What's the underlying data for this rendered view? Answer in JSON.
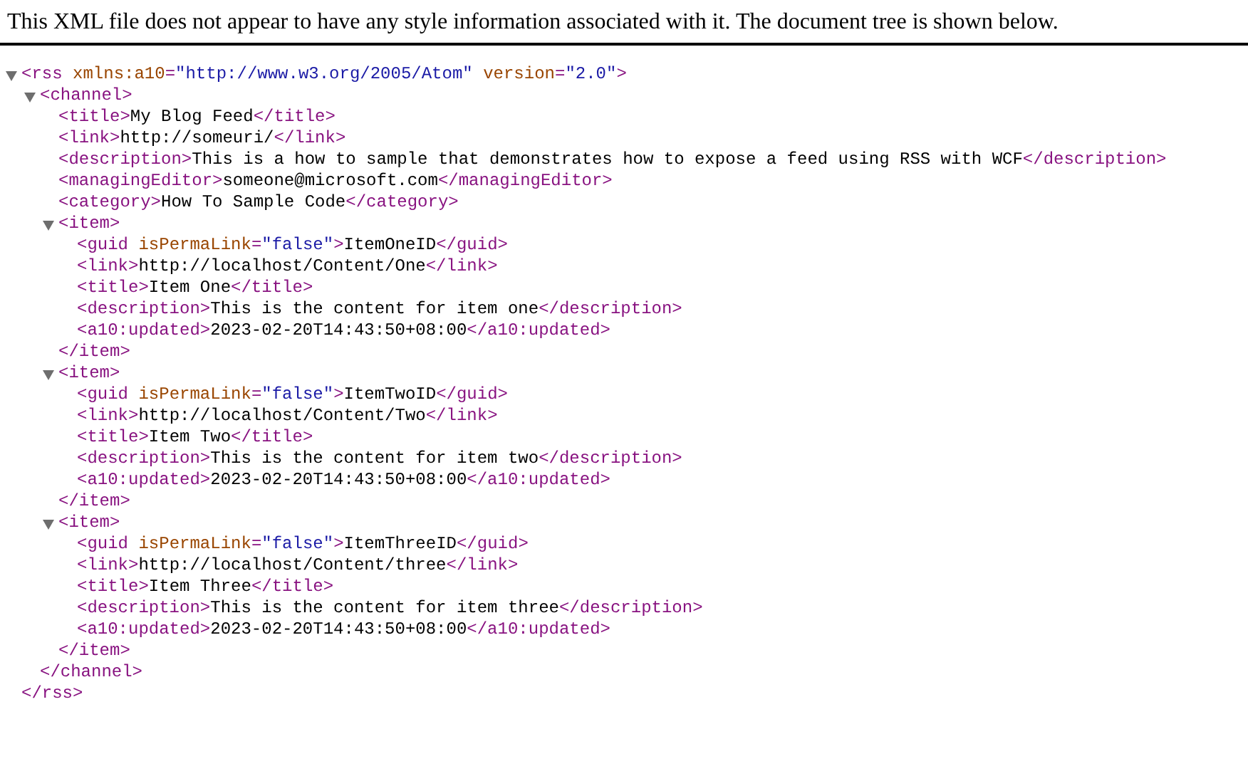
{
  "notice": "This XML file does not appear to have any style information associated with it. The document tree is shown below.",
  "tree": [
    {
      "expanded": true,
      "open": [
        {
          "kind": "tag",
          "text": "<rss "
        },
        {
          "kind": "attr",
          "text": "xmlns:a10"
        },
        {
          "kind": "tag",
          "text": "="
        },
        {
          "kind": "value",
          "text": "\"http://www.w3.org/2005/Atom\" "
        },
        {
          "kind": "attr",
          "text": "version"
        },
        {
          "kind": "tag",
          "text": "="
        },
        {
          "kind": "value",
          "text": "\"2.0\""
        },
        {
          "kind": "tag",
          "text": ">"
        }
      ],
      "close": [
        {
          "kind": "tag",
          "text": "</rss>"
        }
      ],
      "children": [
        {
          "expanded": true,
          "open": [
            {
              "kind": "tag",
              "text": "<channel>"
            }
          ],
          "close": [
            {
              "kind": "tag",
              "text": "</channel>"
            }
          ],
          "children": [
            {
              "line": [
                {
                  "kind": "tag",
                  "text": "<title>"
                },
                {
                  "kind": "text",
                  "text": "My Blog Feed"
                },
                {
                  "kind": "tag",
                  "text": "</title>"
                }
              ]
            },
            {
              "line": [
                {
                  "kind": "tag",
                  "text": "<link>"
                },
                {
                  "kind": "text",
                  "text": "http://someuri/"
                },
                {
                  "kind": "tag",
                  "text": "</link>"
                }
              ]
            },
            {
              "line": [
                {
                  "kind": "tag",
                  "text": "<description>"
                },
                {
                  "kind": "text",
                  "text": "This is a how to sample that demonstrates how to expose a feed using RSS with WCF"
                },
                {
                  "kind": "tag",
                  "text": "</description>"
                }
              ]
            },
            {
              "line": [
                {
                  "kind": "tag",
                  "text": "<managingEditor>"
                },
                {
                  "kind": "text",
                  "text": "someone@microsoft.com"
                },
                {
                  "kind": "tag",
                  "text": "</managingEditor>"
                }
              ]
            },
            {
              "line": [
                {
                  "kind": "tag",
                  "text": "<category>"
                },
                {
                  "kind": "text",
                  "text": "How To Sample Code"
                },
                {
                  "kind": "tag",
                  "text": "</category>"
                }
              ]
            },
            {
              "expanded": true,
              "open": [
                {
                  "kind": "tag",
                  "text": "<item>"
                }
              ],
              "close": [
                {
                  "kind": "tag",
                  "text": "</item>"
                }
              ],
              "children": [
                {
                  "line": [
                    {
                      "kind": "tag",
                      "text": "<guid "
                    },
                    {
                      "kind": "attr",
                      "text": "isPermaLink"
                    },
                    {
                      "kind": "tag",
                      "text": "="
                    },
                    {
                      "kind": "value",
                      "text": "\"false\""
                    },
                    {
                      "kind": "tag",
                      "text": ">"
                    },
                    {
                      "kind": "text",
                      "text": "ItemOneID"
                    },
                    {
                      "kind": "tag",
                      "text": "</guid>"
                    }
                  ]
                },
                {
                  "line": [
                    {
                      "kind": "tag",
                      "text": "<link>"
                    },
                    {
                      "kind": "text",
                      "text": "http://localhost/Content/One"
                    },
                    {
                      "kind": "tag",
                      "text": "</link>"
                    }
                  ]
                },
                {
                  "line": [
                    {
                      "kind": "tag",
                      "text": "<title>"
                    },
                    {
                      "kind": "text",
                      "text": "Item One"
                    },
                    {
                      "kind": "tag",
                      "text": "</title>"
                    }
                  ]
                },
                {
                  "line": [
                    {
                      "kind": "tag",
                      "text": "<description>"
                    },
                    {
                      "kind": "text",
                      "text": "This is the content for item one"
                    },
                    {
                      "kind": "tag",
                      "text": "</description>"
                    }
                  ]
                },
                {
                  "line": [
                    {
                      "kind": "tag",
                      "text": "<a10:updated>"
                    },
                    {
                      "kind": "text",
                      "text": "2023-02-20T14:43:50+08:00"
                    },
                    {
                      "kind": "tag",
                      "text": "</a10:updated>"
                    }
                  ]
                }
              ]
            },
            {
              "expanded": true,
              "open": [
                {
                  "kind": "tag",
                  "text": "<item>"
                }
              ],
              "close": [
                {
                  "kind": "tag",
                  "text": "</item>"
                }
              ],
              "children": [
                {
                  "line": [
                    {
                      "kind": "tag",
                      "text": "<guid "
                    },
                    {
                      "kind": "attr",
                      "text": "isPermaLink"
                    },
                    {
                      "kind": "tag",
                      "text": "="
                    },
                    {
                      "kind": "value",
                      "text": "\"false\""
                    },
                    {
                      "kind": "tag",
                      "text": ">"
                    },
                    {
                      "kind": "text",
                      "text": "ItemTwoID"
                    },
                    {
                      "kind": "tag",
                      "text": "</guid>"
                    }
                  ]
                },
                {
                  "line": [
                    {
                      "kind": "tag",
                      "text": "<link>"
                    },
                    {
                      "kind": "text",
                      "text": "http://localhost/Content/Two"
                    },
                    {
                      "kind": "tag",
                      "text": "</link>"
                    }
                  ]
                },
                {
                  "line": [
                    {
                      "kind": "tag",
                      "text": "<title>"
                    },
                    {
                      "kind": "text",
                      "text": "Item Two"
                    },
                    {
                      "kind": "tag",
                      "text": "</title>"
                    }
                  ]
                },
                {
                  "line": [
                    {
                      "kind": "tag",
                      "text": "<description>"
                    },
                    {
                      "kind": "text",
                      "text": "This is the content for item two"
                    },
                    {
                      "kind": "tag",
                      "text": "</description>"
                    }
                  ]
                },
                {
                  "line": [
                    {
                      "kind": "tag",
                      "text": "<a10:updated>"
                    },
                    {
                      "kind": "text",
                      "text": "2023-02-20T14:43:50+08:00"
                    },
                    {
                      "kind": "tag",
                      "text": "</a10:updated>"
                    }
                  ]
                }
              ]
            },
            {
              "expanded": true,
              "open": [
                {
                  "kind": "tag",
                  "text": "<item>"
                }
              ],
              "close": [
                {
                  "kind": "tag",
                  "text": "</item>"
                }
              ],
              "children": [
                {
                  "line": [
                    {
                      "kind": "tag",
                      "text": "<guid "
                    },
                    {
                      "kind": "attr",
                      "text": "isPermaLink"
                    },
                    {
                      "kind": "tag",
                      "text": "="
                    },
                    {
                      "kind": "value",
                      "text": "\"false\""
                    },
                    {
                      "kind": "tag",
                      "text": ">"
                    },
                    {
                      "kind": "text",
                      "text": "ItemThreeID"
                    },
                    {
                      "kind": "tag",
                      "text": "</guid>"
                    }
                  ]
                },
                {
                  "line": [
                    {
                      "kind": "tag",
                      "text": "<link>"
                    },
                    {
                      "kind": "text",
                      "text": "http://localhost/Content/three"
                    },
                    {
                      "kind": "tag",
                      "text": "</link>"
                    }
                  ]
                },
                {
                  "line": [
                    {
                      "kind": "tag",
                      "text": "<title>"
                    },
                    {
                      "kind": "text",
                      "text": "Item Three"
                    },
                    {
                      "kind": "tag",
                      "text": "</title>"
                    }
                  ]
                },
                {
                  "line": [
                    {
                      "kind": "tag",
                      "text": "<description>"
                    },
                    {
                      "kind": "text",
                      "text": "This is the content for item three"
                    },
                    {
                      "kind": "tag",
                      "text": "</description>"
                    }
                  ]
                },
                {
                  "line": [
                    {
                      "kind": "tag",
                      "text": "<a10:updated>"
                    },
                    {
                      "kind": "text",
                      "text": "2023-02-20T14:43:50+08:00"
                    },
                    {
                      "kind": "tag",
                      "text": "</a10:updated>"
                    }
                  ]
                }
              ]
            }
          ]
        }
      ]
    }
  ]
}
